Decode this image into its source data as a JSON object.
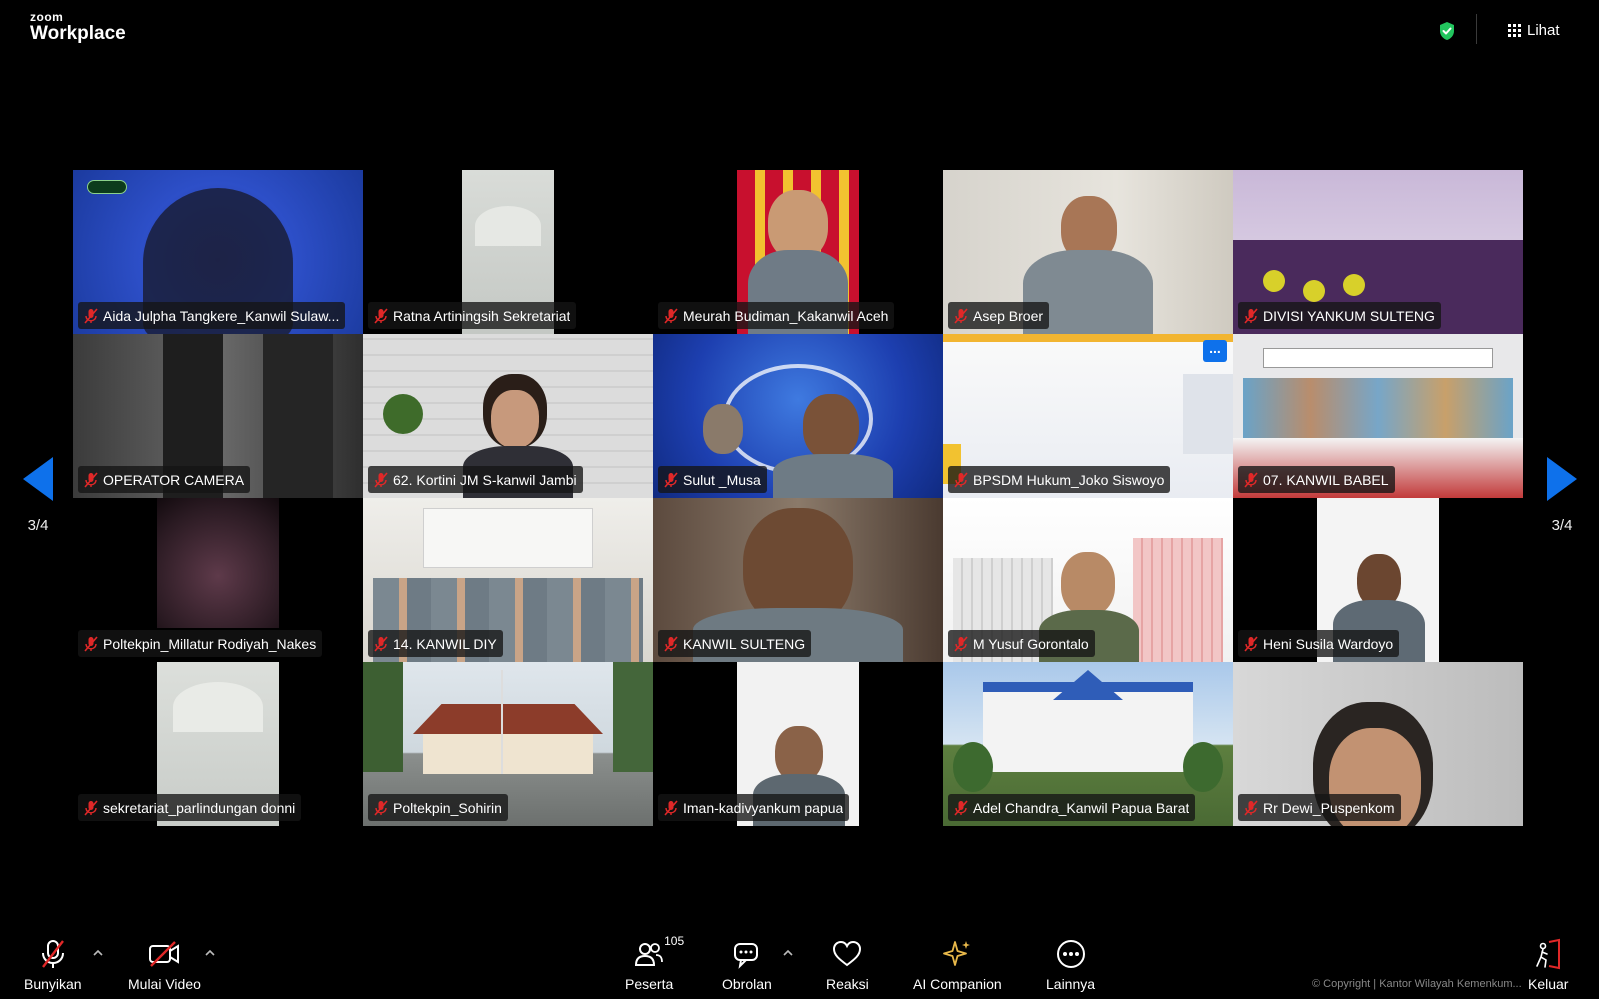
{
  "app": {
    "brand_top": "zoom",
    "brand_bottom": "Workplace",
    "view_label": "Lihat"
  },
  "pager": {
    "left_label": "3/4",
    "right_label": "3/4"
  },
  "participants": [
    {
      "name": "Aida Julpha Tangkere_Kanwil Sulaw...",
      "muted": true
    },
    {
      "name": "Ratna Artiningsih Sekretariat",
      "muted": true
    },
    {
      "name": "Meurah Budiman_Kakanwil Aceh",
      "muted": true
    },
    {
      "name": "Asep Broer",
      "muted": true
    },
    {
      "name": "DIVISI YANKUM SULTENG",
      "muted": true
    },
    {
      "name": "OPERATOR CAMERA",
      "muted": true
    },
    {
      "name": "62. Kortini JM S-kanwil Jambi",
      "muted": true
    },
    {
      "name": "Sulut _Musa",
      "muted": true
    },
    {
      "name": "BPSDM Hukum_Joko Siswoyo",
      "muted": true
    },
    {
      "name": "07. KANWIL BABEL",
      "muted": true
    },
    {
      "name": "Poltekpin_Millatur Rodiyah_Nakes",
      "muted": true
    },
    {
      "name": "14. KANWIL DIY",
      "muted": true
    },
    {
      "name": "KANWIL SULTENG",
      "muted": true
    },
    {
      "name": "M Yusuf Gorontalo",
      "muted": true
    },
    {
      "name": "Heni Susila Wardoyo",
      "muted": true
    },
    {
      "name": "sekretariat_parlindungan donni",
      "muted": true
    },
    {
      "name": "Poltekpin_Sohirin",
      "muted": true
    },
    {
      "name": "Iman-kadivyankum papua",
      "muted": true
    },
    {
      "name": "Adel Chandra_Kanwil Papua Barat",
      "muted": true
    },
    {
      "name": "Rr Dewi_Puspenkom",
      "muted": true
    }
  ],
  "tile_overlay": {
    "more_label": "..."
  },
  "toolbar": {
    "unmute_label": "Bunyikan",
    "video_label": "Mulai Video",
    "participants_label": "Peserta",
    "participants_count": "105",
    "chat_label": "Obrolan",
    "reactions_label": "Reaksi",
    "ai_label": "AI Companion",
    "more_label": "Lainnya",
    "leave_label": "Keluar"
  },
  "footer": {
    "copyright": "© Copyright | Kantor Wilayah Kemenkum..."
  },
  "colors": {
    "accent_blue": "#0e71eb",
    "mute_red": "#e02828",
    "shield_green": "#22c55e",
    "ai_gold": "#e8b84a",
    "leave_red": "#e02828"
  }
}
